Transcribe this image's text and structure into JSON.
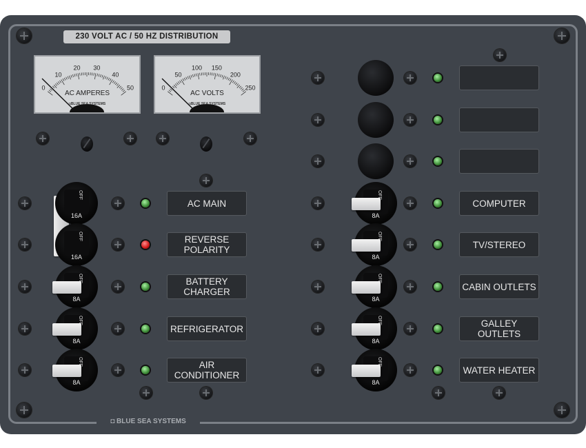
{
  "panel": {
    "title": "230 VOLT AC / 50 HZ DISTRIBUTION",
    "brand": "◘ BLUE SEA SYSTEMS"
  },
  "meters": [
    {
      "name": "ac-amperes-meter",
      "label": "AC AMPERES",
      "brand": "◘BLUE SEA SYSTEMS",
      "scale": [
        "0",
        "10",
        "20",
        "30",
        "40",
        "50"
      ]
    },
    {
      "name": "ac-volts-meter",
      "label": "AC VOLTS",
      "brand": "◘BLUE SEA SYSTEMS",
      "scale": [
        "0",
        "50",
        "100",
        "150",
        "200",
        "250"
      ]
    }
  ],
  "left_circuits": [
    {
      "label": "AC MAIN",
      "amp": "16A",
      "off": "OFF",
      "led": "green"
    },
    {
      "label": "REVERSE\nPOLARITY",
      "amp": "16A",
      "off": "OFF",
      "led": "red"
    },
    {
      "label": "BATTERY\nCHARGER",
      "amp": "8A",
      "off": "OFF",
      "led": "green"
    },
    {
      "label": "REFRIGERATOR",
      "amp": "8A",
      "off": "OFF",
      "led": "green"
    },
    {
      "label": "AIR\nCONDITIONER",
      "amp": "8A",
      "off": "OFF",
      "led": "green"
    }
  ],
  "right_circuits": [
    {
      "label": "",
      "blank": true,
      "led": "green"
    },
    {
      "label": "",
      "blank": true,
      "led": "green"
    },
    {
      "label": "",
      "blank": true,
      "led": "green"
    },
    {
      "label": "COMPUTER",
      "amp": "8A",
      "off": "OFF",
      "led": "green"
    },
    {
      "label": "TV/STEREO",
      "amp": "8A",
      "off": "OFF",
      "led": "green"
    },
    {
      "label": "CABIN OUTLETS",
      "amp": "8A",
      "off": "OFF",
      "led": "green"
    },
    {
      "label": "GALLEY OUTLETS",
      "amp": "8A",
      "off": "OFF",
      "led": "green"
    },
    {
      "label": "WATER HEATER",
      "amp": "8A",
      "off": "OFF",
      "led": "green"
    }
  ],
  "colors": {
    "panel": "#3f444b",
    "label_bg": "#2a2d31",
    "led_green": "#4caf50",
    "led_red": "#d01818"
  }
}
